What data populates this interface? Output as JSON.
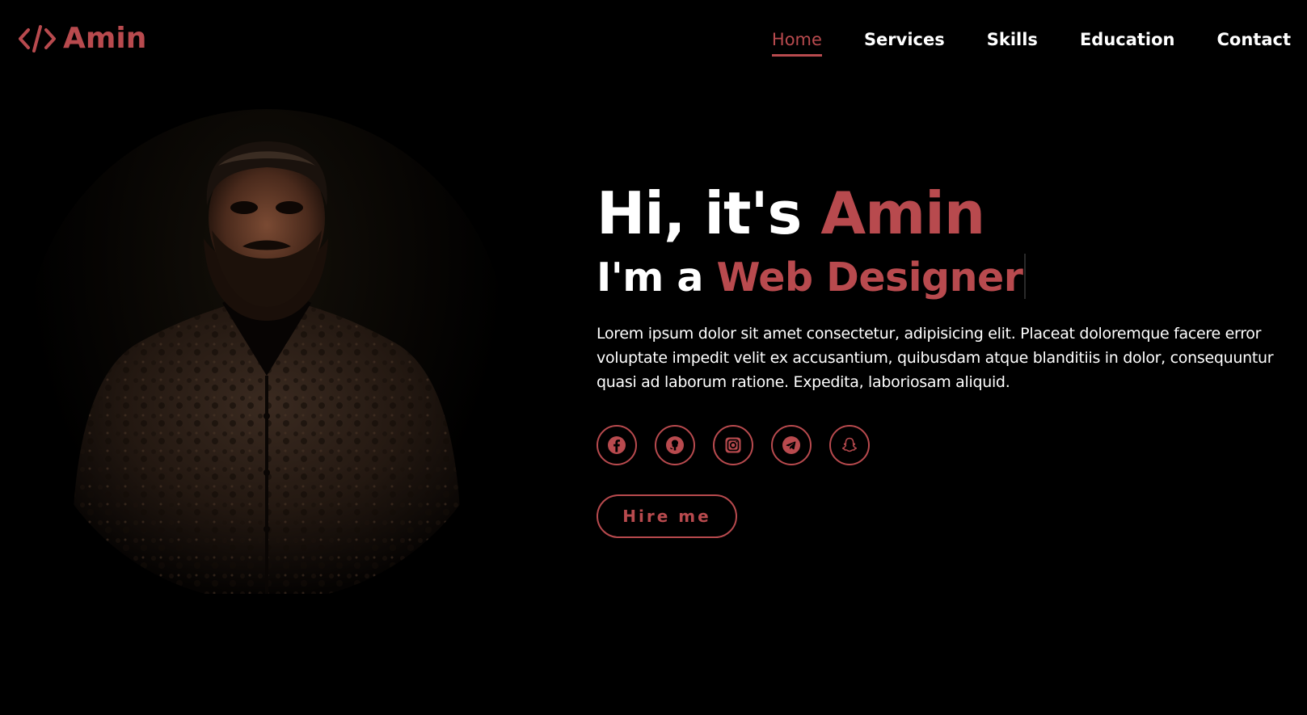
{
  "header": {
    "logo_text": "Amin",
    "nav": [
      {
        "label": "Home",
        "active": true
      },
      {
        "label": "Services",
        "active": false
      },
      {
        "label": "Skills",
        "active": false
      },
      {
        "label": "Education",
        "active": false
      },
      {
        "label": "Contact",
        "active": false
      }
    ]
  },
  "hero": {
    "greeting_prefix": "Hi, it's ",
    "greeting_name": "Amin",
    "role_prefix": "I'm a ",
    "role_title": "Web Designer",
    "intro": "Lorem ipsum dolor sit amet consectetur, adipisicing elit. Placeat doloremque facere error voluptate impedit velit ex accusantium, quibusdam atque blanditiis in dolor, consequuntur quasi ad laborum ratione. Expedita, laboriosam aliquid.",
    "socials": [
      "facebook-icon",
      "github-icon",
      "instagram-icon",
      "telegram-icon",
      "snapchat-icon"
    ],
    "hire_label": "Hire me"
  },
  "colors": {
    "background": "#000000",
    "accent": "#b84a4e",
    "text": "#ffffff"
  }
}
